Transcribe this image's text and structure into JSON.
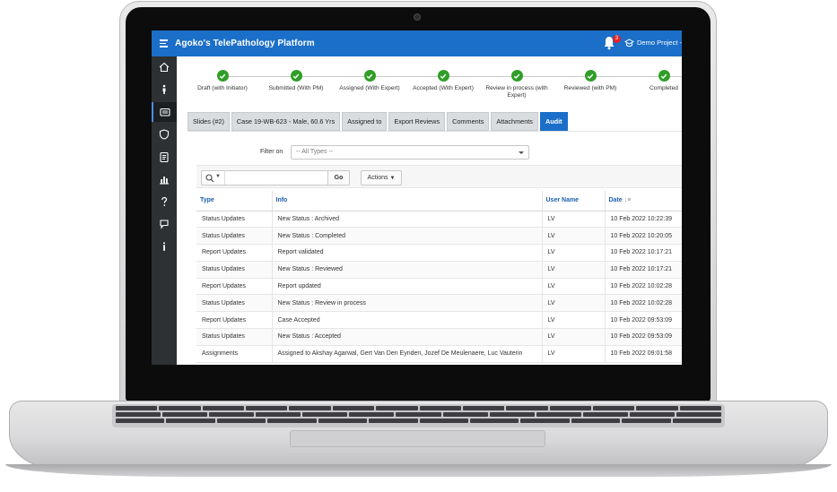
{
  "app": {
    "title": "Agoko's TelePathology Platform",
    "notification_count": "3",
    "project_label": "Demo Project - P"
  },
  "colors": {
    "accent": "#1b6fc8",
    "success": "#2f9e27",
    "sidebar": "#2d3133",
    "badge": "#e5242a"
  },
  "sidebar": {
    "items": [
      {
        "icon": "home-icon"
      },
      {
        "icon": "person-icon"
      },
      {
        "icon": "case-icon"
      },
      {
        "icon": "shield-icon"
      },
      {
        "icon": "clipboard-icon"
      },
      {
        "icon": "bar-chart-icon"
      },
      {
        "icon": "help-icon"
      },
      {
        "icon": "chat-icon"
      },
      {
        "icon": "info-icon"
      }
    ]
  },
  "progress": {
    "steps": [
      {
        "label": "Draft (with Initiator)"
      },
      {
        "label": "Submitted (With PM)"
      },
      {
        "label": "Assigned (With Expert)"
      },
      {
        "label": "Accepted (With Expert)"
      },
      {
        "label": "Review in process (with Expert)"
      },
      {
        "label": "Reviewed (with PM)"
      },
      {
        "label": "Completed"
      }
    ]
  },
  "tabs": [
    {
      "label": "Slides (#2)"
    },
    {
      "label": "Case 19-WB-623 - Male, 60.6 Yrs"
    },
    {
      "label": "Assigned to"
    },
    {
      "label": "Export Reviews"
    },
    {
      "label": "Comments"
    },
    {
      "label": "Attachments"
    },
    {
      "label": "Audit"
    }
  ],
  "filter": {
    "label": "Filter on",
    "value": "-- All Types --"
  },
  "toolbar": {
    "search_placeholder": "",
    "go_label": "Go",
    "actions_label": "Actions"
  },
  "table": {
    "headers": {
      "type": "Type",
      "info": "Info",
      "user": "User Name",
      "date": "Date"
    },
    "rows": [
      {
        "type": "Status Updates",
        "info": "New Status : Archived",
        "user": "LV",
        "date": "10 Feb 2022 10:22:39"
      },
      {
        "type": "Status Updates",
        "info": "New Status : Completed",
        "user": "LV",
        "date": "10 Feb 2022 10:20:05"
      },
      {
        "type": "Report Updates",
        "info": "Report validated",
        "user": "LV",
        "date": "10 Feb 2022 10:17:21"
      },
      {
        "type": "Status Updates",
        "info": "New Status : Reviewed",
        "user": "LV",
        "date": "10 Feb 2022 10:17:21"
      },
      {
        "type": "Report Updates",
        "info": "Report updated",
        "user": "LV",
        "date": "10 Feb 2022 10:02:28"
      },
      {
        "type": "Status Updates",
        "info": "New Status : Review in process",
        "user": "LV",
        "date": "10 Feb 2022 10:02:28"
      },
      {
        "type": "Report Updates",
        "info": "Case Accepted",
        "user": "LV",
        "date": "10 Feb 2022 09:53:09"
      },
      {
        "type": "Status Updates",
        "info": "New Status : Accepted",
        "user": "LV",
        "date": "10 Feb 2022 09:53:09"
      },
      {
        "type": "Assignments",
        "info": "Assigned to Akshay Agarwal, Gert Van Den Eynden, Jozef De Meulenaere, Luc Vauterin",
        "user": "LV",
        "date": "10 Feb 2022 09:01:58"
      }
    ]
  }
}
